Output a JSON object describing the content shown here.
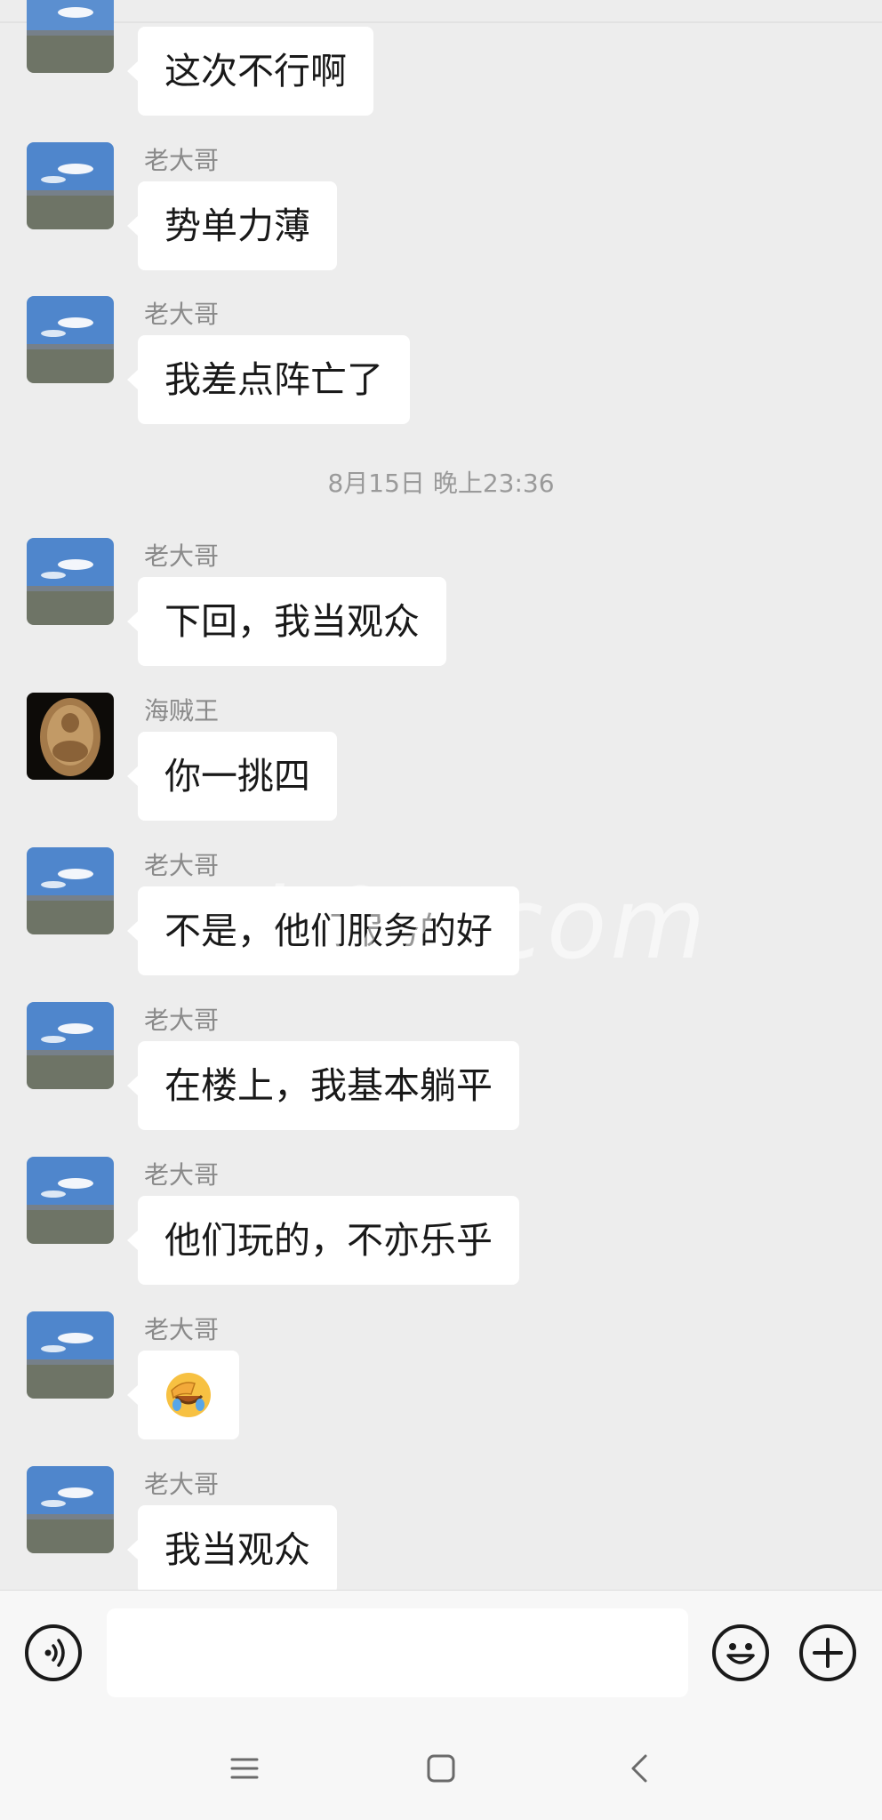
{
  "messages": [
    {
      "sender": "",
      "text": "这次不行啊",
      "avatar": "lake"
    },
    {
      "sender": "老大哥",
      "text": "势单力薄",
      "avatar": "lake"
    },
    {
      "sender": "老大哥",
      "text": "我差点阵亡了",
      "avatar": "lake"
    },
    {
      "sender": "老大哥",
      "text": "下回，我当观众",
      "avatar": "lake"
    },
    {
      "sender": "海贼王",
      "text": "你一挑四",
      "avatar": "amulet"
    },
    {
      "sender": "老大哥",
      "text": "不是，他们服务的好",
      "avatar": "lake"
    },
    {
      "sender": "老大哥",
      "text": "在楼上，我基本躺平",
      "avatar": "lake"
    },
    {
      "sender": "老大哥",
      "text": "他们玩的，不亦乐乎",
      "avatar": "lake"
    },
    {
      "sender": "老大哥",
      "text": "🤦",
      "avatar": "lake",
      "emoji_icon": "facepalm-emoji"
    },
    {
      "sender": "老大哥",
      "text": "我当观众",
      "avatar": "lake"
    }
  ],
  "timestamp": "8月15日 晚上23:36",
  "watermark": "i  07.com",
  "input_bar": {
    "value": "",
    "voice_icon": "voice-icon",
    "emoji_icon": "emoji-icon",
    "plus_icon": "plus-icon"
  },
  "nav_bar": {
    "menu_icon": "menu-icon",
    "home_icon": "home-icon",
    "back_icon": "back-icon"
  }
}
